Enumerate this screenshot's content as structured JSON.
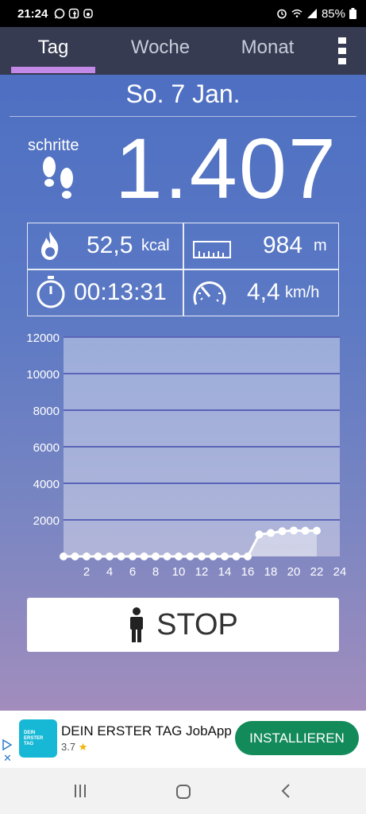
{
  "status_bar": {
    "time": "21:24",
    "battery": "85%",
    "icons": [
      "whatsapp-icon",
      "facebook-icon",
      "lock-screen-icon",
      "alarm-icon",
      "wifi-icon",
      "signal-icon",
      "battery-icon"
    ]
  },
  "tabs": [
    {
      "label": "Tag",
      "active": true
    },
    {
      "label": "Woche",
      "active": false
    },
    {
      "label": "Monat",
      "active": false
    }
  ],
  "date": "So. 7 Jan.",
  "steps": {
    "label": "schritte",
    "value": "1.407"
  },
  "stats": {
    "calories": {
      "value": "52,5",
      "unit": "kcal"
    },
    "distance": {
      "value": "984",
      "unit": "m"
    },
    "duration": {
      "value": "00:13:31"
    },
    "speed": {
      "value": "4,4",
      "unit": "km/h"
    }
  },
  "chart_data": {
    "type": "area",
    "x": [
      0,
      1,
      2,
      3,
      4,
      5,
      6,
      7,
      8,
      9,
      10,
      11,
      12,
      13,
      14,
      15,
      16,
      17,
      18,
      19,
      20,
      21,
      22
    ],
    "y": [
      0,
      0,
      0,
      0,
      0,
      0,
      0,
      0,
      0,
      0,
      0,
      0,
      0,
      0,
      0,
      0,
      0,
      1200,
      1280,
      1380,
      1420,
      1407,
      1407
    ],
    "ylim": [
      0,
      12000
    ],
    "xlim": [
      0,
      24
    ],
    "y_ticks": [
      "2000",
      "4000",
      "6000",
      "8000",
      "10000",
      "12000"
    ],
    "x_ticks": [
      "2",
      "4",
      "6",
      "8",
      "10",
      "12",
      "14",
      "16",
      "18",
      "20",
      "22",
      "24"
    ],
    "grid": true
  },
  "stop_button": {
    "label": "STOP"
  },
  "ad": {
    "logo_text": "DEIN ERSTER TAG",
    "title": "DEIN ERSTER TAG JobApp",
    "rating": "3.7",
    "install_label": "INSTALLIEREN"
  },
  "colors": {
    "accent_tab": "#c389e6",
    "install_button": "#138a5a"
  }
}
